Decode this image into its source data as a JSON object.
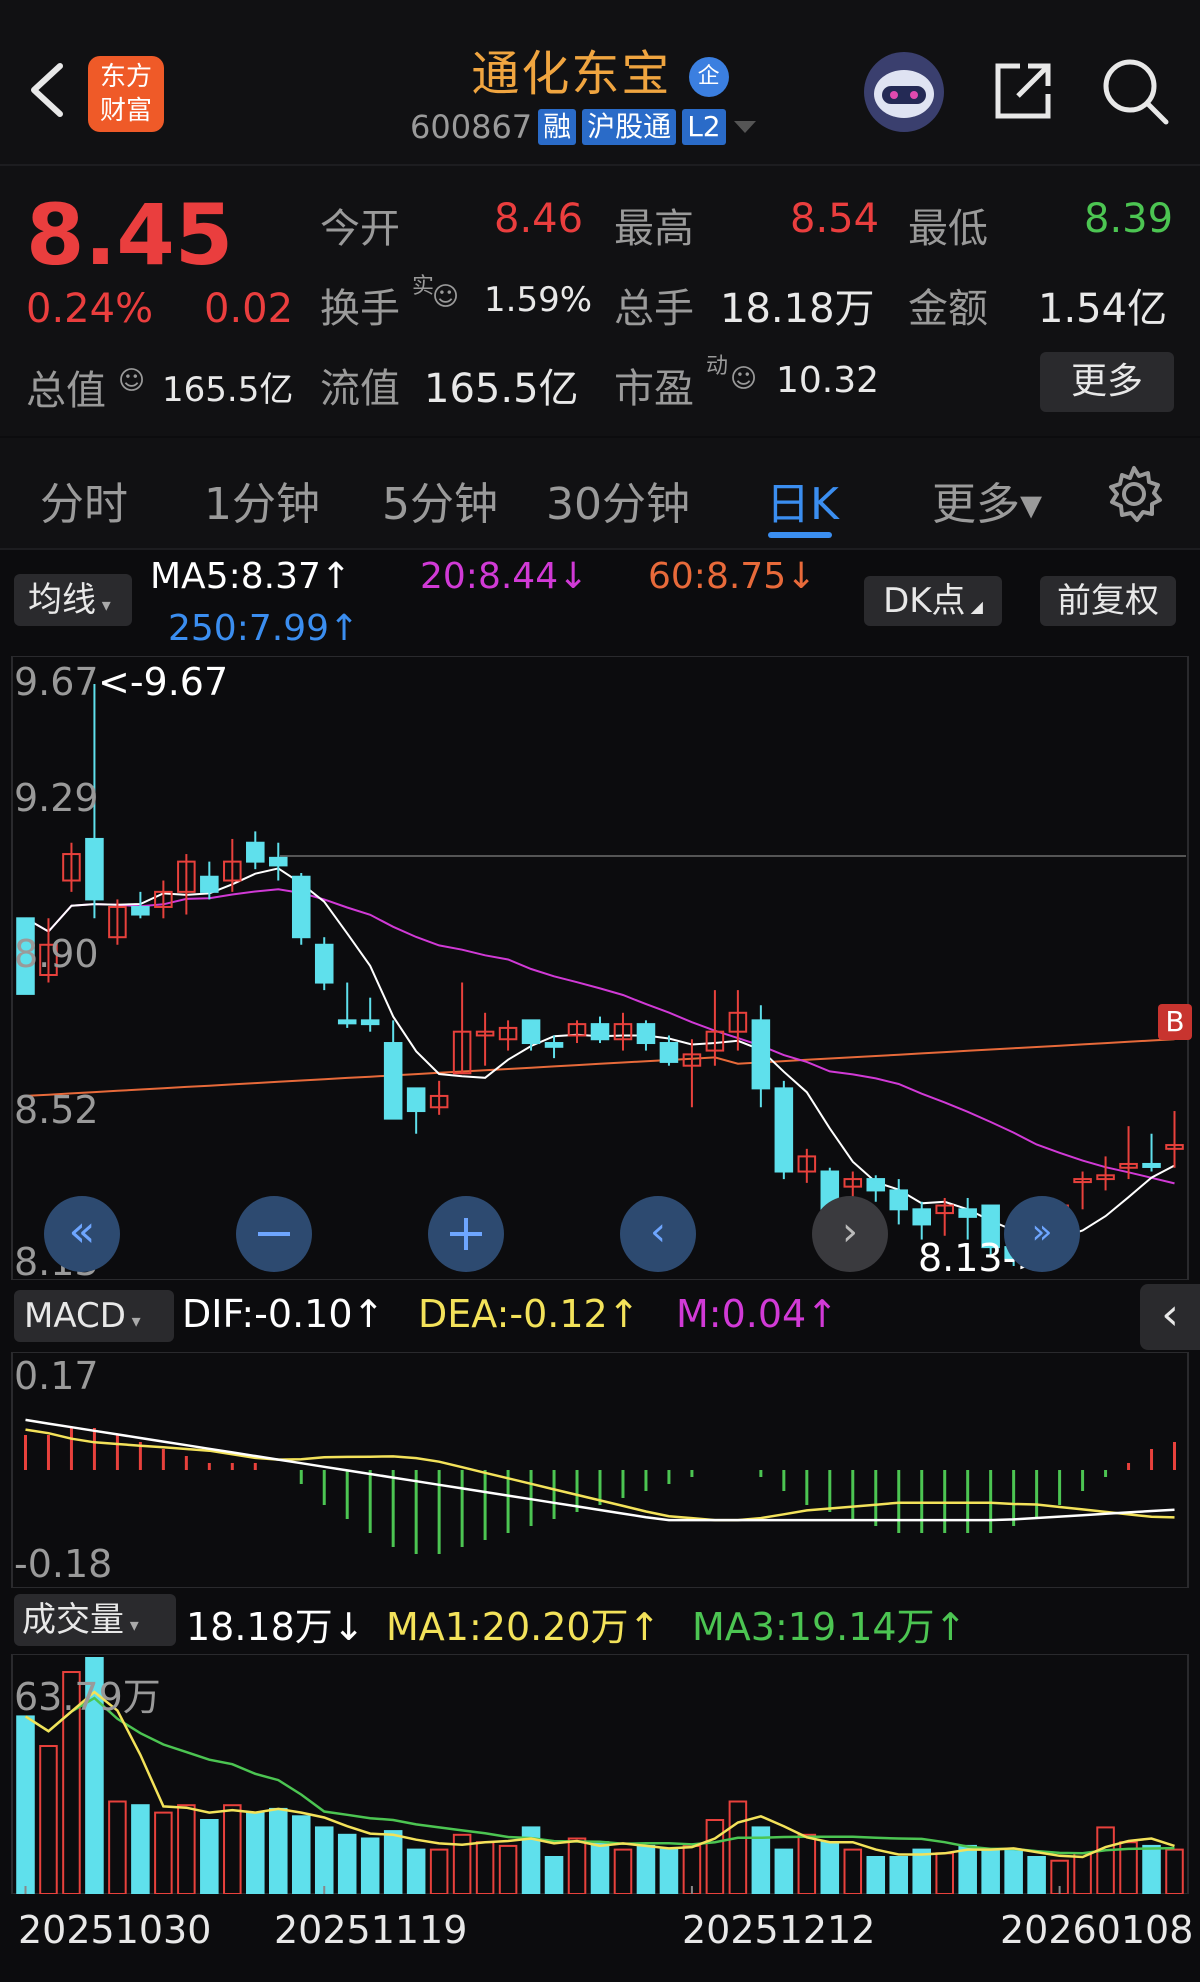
{
  "header": {
    "brand_logo_line1": "东方",
    "brand_logo_line2": "财富",
    "stock_name": "通化东宝",
    "enterprise_badge": "企",
    "stock_code": "600867",
    "tags": [
      "融",
      "沪股通",
      "L2"
    ]
  },
  "quote": {
    "price": "8.45",
    "change_pct": "0.24%",
    "change": "0.02",
    "open_label": "今开",
    "open": "8.46",
    "high_label": "最高",
    "high": "8.54",
    "low_label": "最低",
    "low": "8.39",
    "turnover_label": "换手",
    "turnover_sup": "实",
    "turnover": "1.59%",
    "volume_label": "总手",
    "volume": "18.18万",
    "amount_label": "金额",
    "amount": "1.54亿",
    "mcap_label": "总值",
    "mcap": "165.5亿",
    "float_label": "流值",
    "float": "165.5亿",
    "pe_label": "市盈",
    "pe_sup": "动",
    "pe": "10.32",
    "more_button": "更多"
  },
  "tabs": [
    "分时",
    "1分钟",
    "5分钟",
    "30分钟",
    "日K",
    "更多▾"
  ],
  "active_tab": "日K",
  "kline": {
    "indicator_select": "均线",
    "ma5": "MA5:8.37↑",
    "ma20": "20:8.44↓",
    "ma60": "60:8.75↓",
    "ma250": "250:7.99↑",
    "dk_button": "DK点",
    "adjust_button": "前复权",
    "y_labels": [
      "9.67",
      "9.29",
      "8.90",
      "8.52",
      "8.13"
    ],
    "max_annotation": "<-9.67",
    "min_annotation": "8.13->",
    "buy_marker": "B",
    "colors": {
      "up": "#e8413c",
      "down": "#5fe0ec",
      "ma5": "#ffffff",
      "ma20": "#d13ad6",
      "ma60": "#e86a3a"
    }
  },
  "macd": {
    "select": "MACD",
    "dif": "DIF:-0.10↑",
    "dea": "DEA:-0.12↑",
    "m": "M:0.04↑",
    "y_top": "0.17",
    "y_bottom": "-0.18"
  },
  "volume": {
    "select": "成交量",
    "vol": "18.18万↓",
    "ma1": "MA1:20.20万↑",
    "ma3": "MA3:19.14万↑",
    "y_top": "63.79万",
    "dates": [
      "20251030",
      "20251119",
      "20251212",
      "20260108"
    ]
  },
  "chart_data": {
    "type": "candlestick",
    "y_range": [
      8.13,
      9.67
    ],
    "candles": [
      {
        "o": 8.85,
        "c": 9.05,
        "h": 9.05,
        "l": 8.85,
        "up": false
      },
      {
        "o": 8.9,
        "c": 8.98,
        "h": 9.05,
        "l": 8.88,
        "up": true
      },
      {
        "o": 9.15,
        "c": 9.22,
        "h": 9.25,
        "l": 9.12,
        "up": true
      },
      {
        "o": 9.26,
        "c": 9.1,
        "h": 9.67,
        "l": 9.05,
        "up": false
      },
      {
        "o": 9.0,
        "c": 9.08,
        "h": 9.1,
        "l": 8.98,
        "up": true
      },
      {
        "o": 9.08,
        "c": 9.06,
        "h": 9.12,
        "l": 9.05,
        "up": false
      },
      {
        "o": 9.08,
        "c": 9.12,
        "h": 9.15,
        "l": 9.05,
        "up": true
      },
      {
        "o": 9.12,
        "c": 9.2,
        "h": 9.22,
        "l": 9.06,
        "up": true
      },
      {
        "o": 9.16,
        "c": 9.12,
        "h": 9.2,
        "l": 9.1,
        "up": false
      },
      {
        "o": 9.15,
        "c": 9.2,
        "h": 9.26,
        "l": 9.12,
        "up": true
      },
      {
        "o": 9.25,
        "c": 9.2,
        "h": 9.28,
        "l": 9.18,
        "up": false
      },
      {
        "o": 9.21,
        "c": 9.19,
        "h": 9.25,
        "l": 9.15,
        "up": false
      },
      {
        "o": 9.16,
        "c": 9.0,
        "h": 9.17,
        "l": 8.98,
        "up": false
      },
      {
        "o": 8.98,
        "c": 8.88,
        "h": 9.0,
        "l": 8.86,
        "up": false
      },
      {
        "o": 8.78,
        "c": 8.78,
        "h": 8.88,
        "l": 8.76,
        "up": false
      },
      {
        "o": 8.78,
        "c": 8.77,
        "h": 8.84,
        "l": 8.75,
        "up": false
      },
      {
        "o": 8.72,
        "c": 8.52,
        "h": 8.78,
        "l": 8.52,
        "up": false
      },
      {
        "o": 8.6,
        "c": 8.54,
        "h": 8.6,
        "l": 8.48,
        "up": false
      },
      {
        "o": 8.55,
        "c": 8.58,
        "h": 8.62,
        "l": 8.53,
        "up": true
      },
      {
        "o": 8.64,
        "c": 8.75,
        "h": 8.88,
        "l": 8.64,
        "up": true
      },
      {
        "o": 8.74,
        "c": 8.75,
        "h": 8.8,
        "l": 8.66,
        "up": true
      },
      {
        "o": 8.73,
        "c": 8.76,
        "h": 8.78,
        "l": 8.7,
        "up": true
      },
      {
        "o": 8.78,
        "c": 8.72,
        "h": 8.78,
        "l": 8.7,
        "up": false
      },
      {
        "o": 8.72,
        "c": 8.71,
        "h": 8.74,
        "l": 8.68,
        "up": false
      },
      {
        "o": 8.74,
        "c": 8.77,
        "h": 8.78,
        "l": 8.72,
        "up": true
      },
      {
        "o": 8.77,
        "c": 8.73,
        "h": 8.79,
        "l": 8.72,
        "up": false
      },
      {
        "o": 8.73,
        "c": 8.77,
        "h": 8.8,
        "l": 8.7,
        "up": true
      },
      {
        "o": 8.77,
        "c": 8.72,
        "h": 8.78,
        "l": 8.7,
        "up": false
      },
      {
        "o": 8.72,
        "c": 8.67,
        "h": 8.74,
        "l": 8.66,
        "up": false
      },
      {
        "o": 8.66,
        "c": 8.69,
        "h": 8.73,
        "l": 8.55,
        "up": true
      },
      {
        "o": 8.7,
        "c": 8.75,
        "h": 8.86,
        "l": 8.66,
        "up": true
      },
      {
        "o": 8.75,
        "c": 8.8,
        "h": 8.86,
        "l": 8.7,
        "up": true
      },
      {
        "o": 8.78,
        "c": 8.6,
        "h": 8.82,
        "l": 8.55,
        "up": false
      },
      {
        "o": 8.6,
        "c": 8.38,
        "h": 8.62,
        "l": 8.36,
        "up": false
      },
      {
        "o": 8.38,
        "c": 8.42,
        "h": 8.44,
        "l": 8.35,
        "up": true
      },
      {
        "o": 8.38,
        "c": 8.27,
        "h": 8.39,
        "l": 8.25,
        "up": false
      },
      {
        "o": 8.34,
        "c": 8.36,
        "h": 8.38,
        "l": 8.27,
        "up": true
      },
      {
        "o": 8.36,
        "c": 8.33,
        "h": 8.37,
        "l": 8.3,
        "up": false
      },
      {
        "o": 8.33,
        "c": 8.28,
        "h": 8.36,
        "l": 8.24,
        "up": false
      },
      {
        "o": 8.28,
        "c": 8.24,
        "h": 8.3,
        "l": 8.2,
        "up": false
      },
      {
        "o": 8.27,
        "c": 8.29,
        "h": 8.31,
        "l": 8.21,
        "up": true
      },
      {
        "o": 8.28,
        "c": 8.26,
        "h": 8.31,
        "l": 8.2,
        "up": false
      },
      {
        "o": 8.29,
        "c": 8.18,
        "h": 8.29,
        "l": 8.16,
        "up": false
      },
      {
        "o": 8.18,
        "c": 8.15,
        "h": 8.22,
        "l": 8.13,
        "up": false
      },
      {
        "o": 8.15,
        "c": 8.14,
        "h": 8.16,
        "l": 8.13,
        "up": false
      },
      {
        "o": 8.15,
        "c": 8.29,
        "h": 8.3,
        "l": 8.14,
        "up": true
      },
      {
        "o": 8.36,
        "c": 8.36,
        "h": 8.38,
        "l": 8.28,
        "up": true
      },
      {
        "o": 8.36,
        "c": 8.37,
        "h": 8.42,
        "l": 8.33,
        "up": true
      },
      {
        "o": 8.39,
        "c": 8.4,
        "h": 8.5,
        "l": 8.36,
        "up": true
      },
      {
        "o": 8.4,
        "c": 8.4,
        "h": 8.48,
        "l": 8.38,
        "up": false
      },
      {
        "o": 8.44,
        "c": 8.45,
        "h": 8.54,
        "l": 8.39,
        "up": true
      }
    ],
    "macd_hist": [
      0.05,
      0.05,
      0.06,
      0.06,
      0.05,
      0.04,
      0.03,
      0.02,
      0.01,
      0.01,
      0.01,
      0.0,
      -0.02,
      -0.05,
      -0.07,
      -0.09,
      -0.11,
      -0.12,
      -0.12,
      -0.11,
      -0.1,
      -0.09,
      -0.08,
      -0.07,
      -0.06,
      -0.05,
      -0.04,
      -0.03,
      -0.02,
      -0.01,
      0.0,
      0.0,
      -0.01,
      -0.03,
      -0.05,
      -0.06,
      -0.07,
      -0.08,
      -0.09,
      -0.09,
      -0.09,
      -0.09,
      -0.09,
      -0.08,
      -0.07,
      -0.05,
      -0.03,
      -0.01,
      0.01,
      0.03,
      0.04
    ],
    "volume": [
      48,
      40,
      60,
      63.79,
      25,
      24,
      22,
      24,
      20,
      24,
      22,
      23,
      21,
      18,
      16,
      15,
      17,
      12,
      12,
      16,
      14,
      13,
      18,
      10,
      15,
      14,
      12,
      13,
      12,
      13,
      20,
      25,
      18,
      12,
      16,
      14,
      12,
      10,
      10,
      12,
      11,
      13,
      12,
      12,
      10,
      9,
      11,
      18,
      14,
      13,
      12
    ]
  }
}
